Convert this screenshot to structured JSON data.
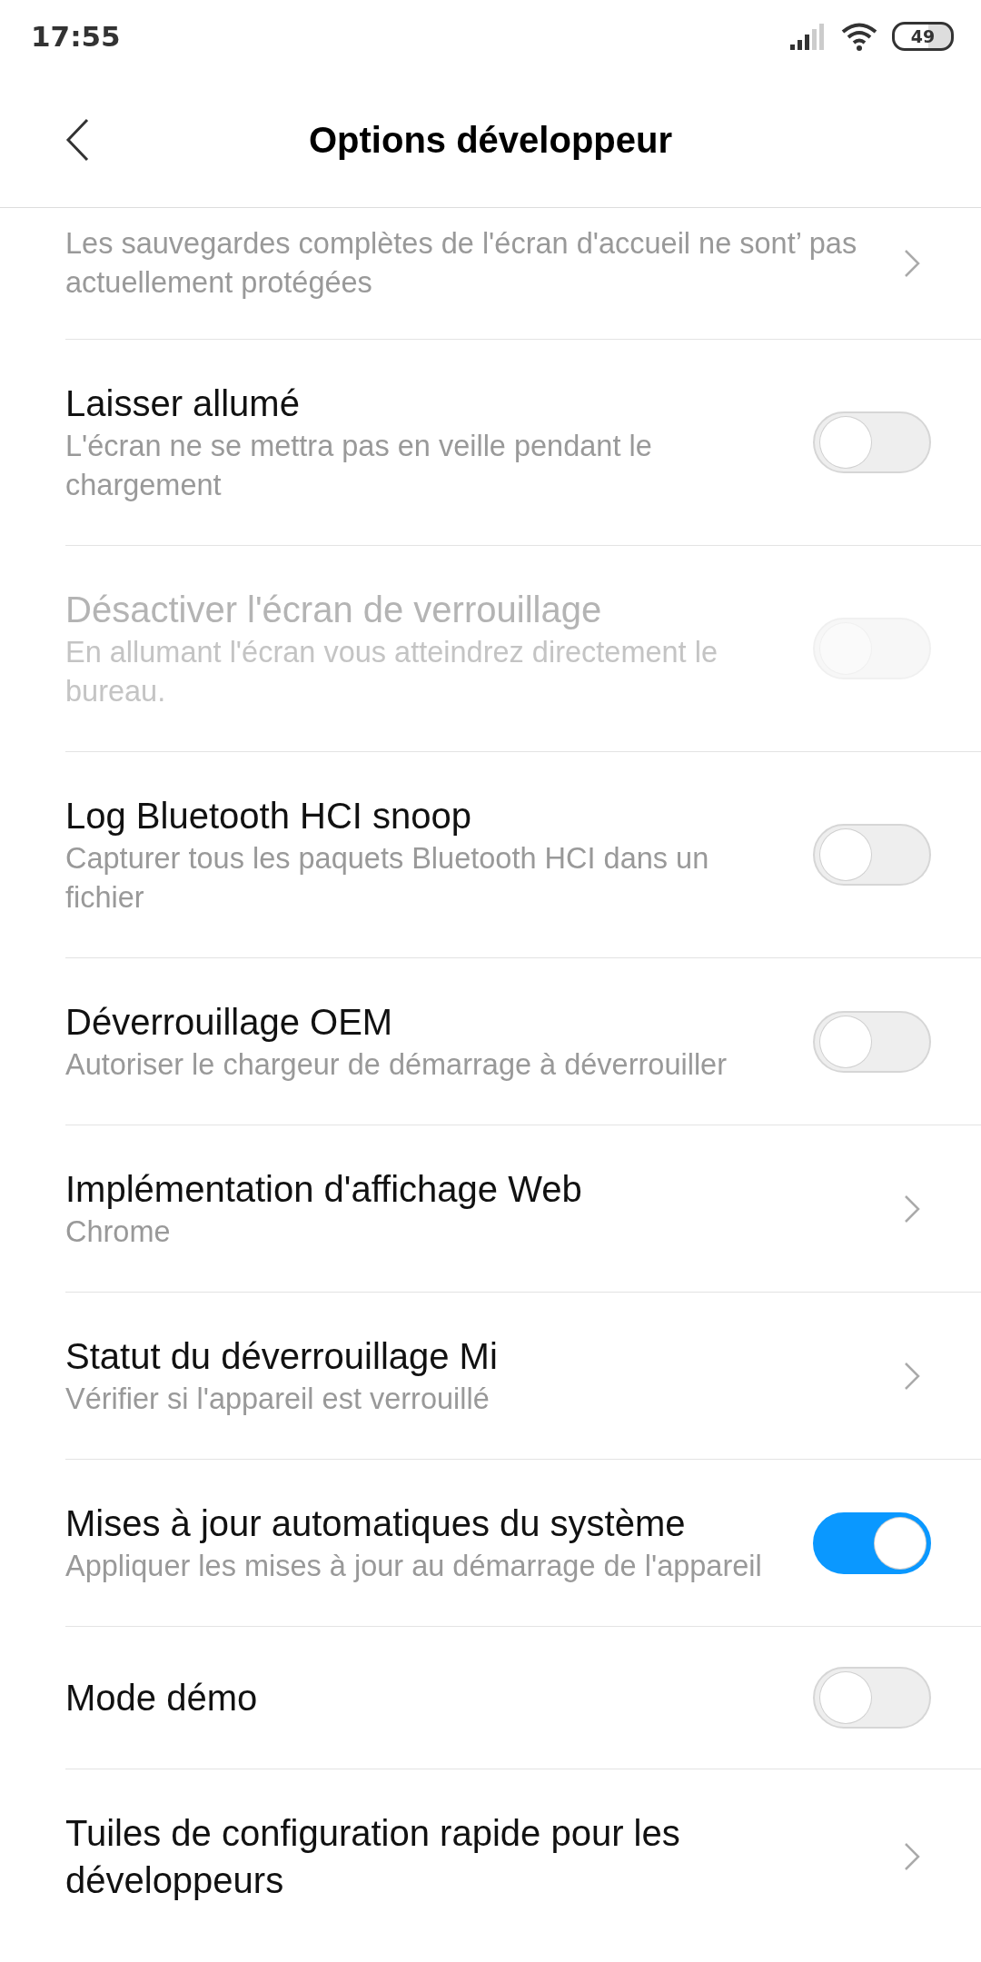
{
  "status_bar": {
    "time": "17:55",
    "battery": "49"
  },
  "header": {
    "title": "Options développeur"
  },
  "items": [
    {
      "kind": "link",
      "subtitle": "Les sauvegardes complètes de l'écran d'accueil ne sont’ pas actuellement protégées"
    },
    {
      "kind": "toggle",
      "title": "Laisser allumé",
      "subtitle": "L'écran ne se mettra pas en veille pendant le chargement",
      "on": false,
      "disabled": false
    },
    {
      "kind": "toggle",
      "title": "Désactiver l'écran de verrouillage",
      "subtitle": "En allumant l'écran vous atteindrez directement le bureau.",
      "on": false,
      "disabled": true
    },
    {
      "kind": "toggle",
      "title": "Log Bluetooth HCI snoop",
      "subtitle": "Capturer tous les paquets Bluetooth HCI dans un fichier",
      "on": false,
      "disabled": false
    },
    {
      "kind": "toggle",
      "title": "Déverrouillage OEM",
      "subtitle": "Autoriser le chargeur de démarrage à déverrouiller",
      "on": false,
      "disabled": false
    },
    {
      "kind": "link",
      "title": "Implémentation d'affichage Web",
      "subtitle": "Chrome"
    },
    {
      "kind": "link",
      "title": "Statut du déverrouillage Mi",
      "subtitle": "Vérifier si l'appareil est verrouillé"
    },
    {
      "kind": "toggle",
      "title": "Mises à jour automatiques du système",
      "subtitle": "Appliquer les mises à jour au démarrage de l'appareil",
      "on": true,
      "disabled": false
    },
    {
      "kind": "toggle",
      "title": "Mode démo",
      "on": false,
      "disabled": false
    },
    {
      "kind": "link",
      "title": "Tuiles de configuration rapide pour les développeurs"
    }
  ]
}
